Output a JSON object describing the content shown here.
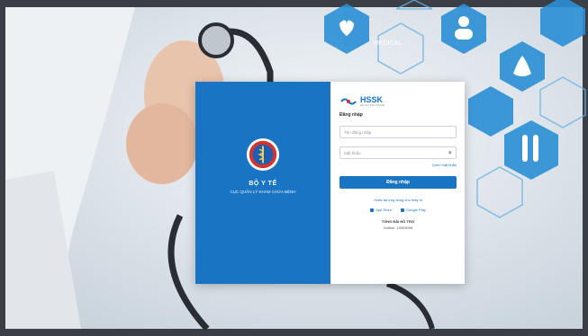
{
  "left_panel": {
    "ministry_name": "BỘ Y TẾ",
    "ministry_subtitle": "CỤC QUẢN LÝ KHÁM CHỮA BỆNH"
  },
  "right_panel": {
    "logo_text": "HSSK",
    "logo_tagline": "HỒ SƠ SỨC KHỎE",
    "heading": "Đăng nhập",
    "username_placeholder": "Tên đăng nhập",
    "password_placeholder": "Mật khẩu",
    "forgot_password": "Quên mật khẩu",
    "login_button": "Đăng nhập",
    "or_text": "Hoặc tải ứng dụng cho máy di",
    "app_store": "App Store",
    "google_play": "Google Play",
    "support_title": "TỔNG ĐÀI HỖ TRỢ",
    "hotline": "Hotline: 19009095"
  },
  "background": {
    "medical_label": "MEDICAL"
  }
}
